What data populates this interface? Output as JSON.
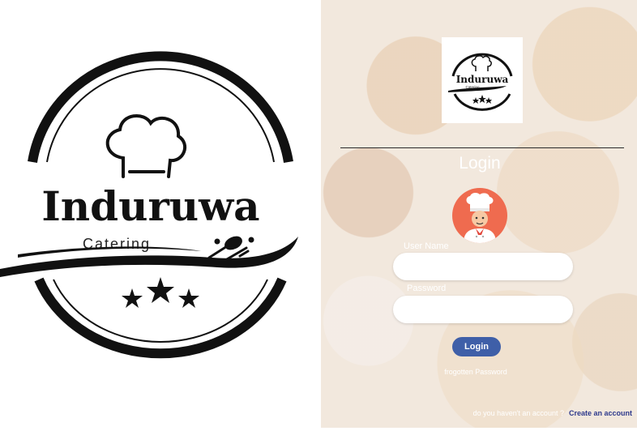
{
  "brand": {
    "name": "Induruwa",
    "tagline": "Catering"
  },
  "login": {
    "title": "Login",
    "username_label": "User Name",
    "username_value": "",
    "password_label": "Password",
    "password_value": "",
    "button_label": "Login",
    "forgot_label": "frogotten Password",
    "no_account_text": "do you haven't an account ?",
    "create_account_label": "Create an account"
  }
}
